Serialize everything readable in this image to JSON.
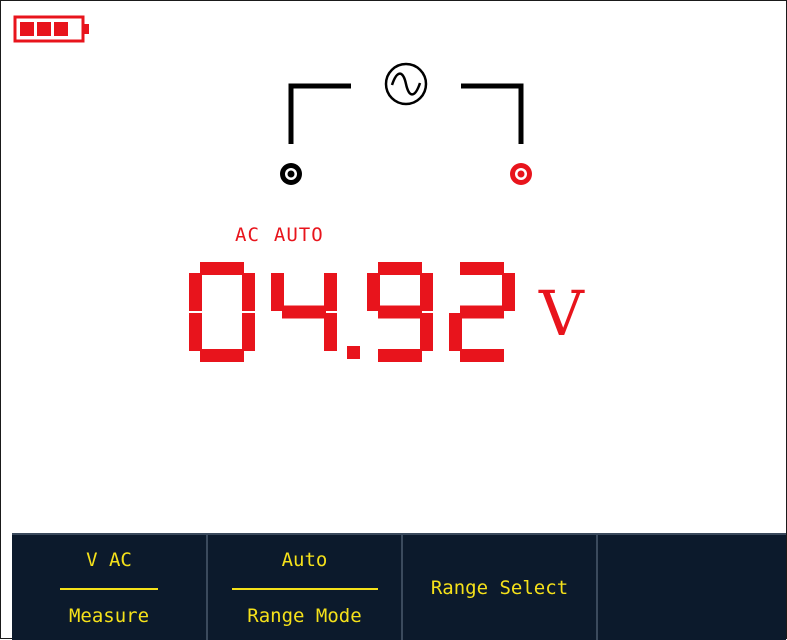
{
  "status": {
    "coupling": "AC",
    "range_mode": "AUTO"
  },
  "reading": {
    "value": "04.92",
    "unit": "V"
  },
  "battery": {
    "level": 0.75,
    "color": "#e8141c"
  },
  "icons": {
    "battery": "battery-icon",
    "signal": "ac-sine-wave-icon",
    "probe_com": "black-probe-terminal-icon",
    "probe_v": "red-probe-terminal-icon"
  },
  "softkeys": [
    {
      "top": "V AC",
      "bottom": "Measure"
    },
    {
      "top": "Auto",
      "bottom": "Range Mode"
    },
    {
      "label": "Range Select"
    }
  ],
  "colors": {
    "display_red": "#e8141c",
    "softkey_text": "#f5e11a",
    "softkey_bg": "#0c1a2c"
  }
}
